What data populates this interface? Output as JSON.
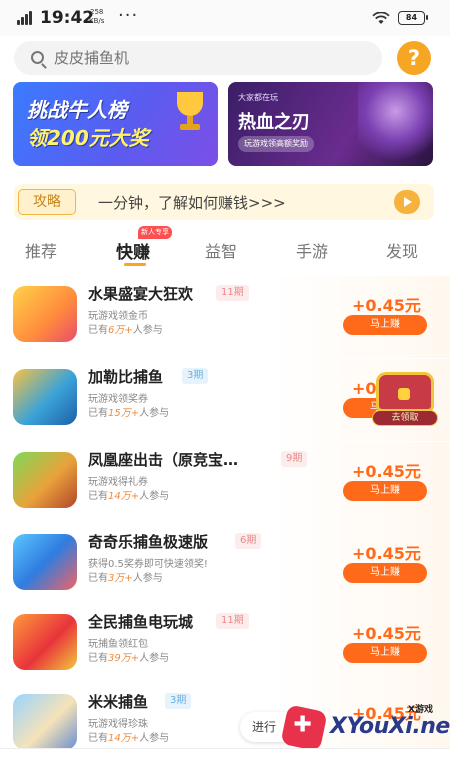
{
  "status_bar": {
    "time": "19:42",
    "net_speed": "258",
    "net_unit": "KB/s",
    "more": "···",
    "battery": "84"
  },
  "search": {
    "placeholder": "皮皮捕鱼机",
    "help_label": "?"
  },
  "banners": [
    {
      "line1": "挑战牛人榜",
      "line2": "领200元大奖"
    },
    {
      "small": "大家都在玩",
      "title": "热血之刃",
      "button": "玩游戏领高额奖励"
    }
  ],
  "guide": {
    "tag": "攻略",
    "text": "一分钟，了解如何赚钱>>>"
  },
  "tabs": [
    {
      "label": "推荐"
    },
    {
      "label": "快赚",
      "badge": "新人专享"
    },
    {
      "label": "益智"
    },
    {
      "label": "手游"
    },
    {
      "label": "发现"
    }
  ],
  "games": [
    {
      "name": "水果盛宴大狂欢",
      "period": "11期",
      "desc": "玩游戏领金币",
      "prefix": "已有",
      "count": "6万+",
      "suffix": "人参与",
      "reward": "+0.45元",
      "button": "马上赚"
    },
    {
      "name": "加勒比捕鱼",
      "period": "3期",
      "desc": "玩游戏领奖券",
      "prefix": "已有",
      "count": "15万+",
      "suffix": "人参与",
      "reward": "+0.45元",
      "button": "马上赚"
    },
    {
      "name": "凤凰座出击（原竞宝…",
      "period": "9期",
      "desc": "玩游戏得礼券",
      "prefix": "已有",
      "count": "14万+",
      "suffix": "人参与",
      "reward": "+0.45元",
      "button": "马上赚"
    },
    {
      "name": "奇奇乐捕鱼极速版",
      "period": "6期",
      "desc": "获得0.5奖券即可快速领奖!",
      "prefix": "已有",
      "count": "3万+",
      "suffix": "人参与",
      "reward": "+0.45元",
      "button": "马上赚"
    },
    {
      "name": "全民捕鱼电玩城",
      "period": "11期",
      "desc": "玩捕鱼领红包",
      "prefix": "已有",
      "count": "39万+",
      "suffix": "人参与",
      "reward": "+0.45元",
      "button": "马上赚"
    },
    {
      "name": "米米捕鱼",
      "period": "3期",
      "desc": "玩游戏得珍珠",
      "prefix": "已有",
      "count": "14万+",
      "suffix": "人参与",
      "reward": "+0.45元",
      "button": "马上赚"
    }
  ],
  "chest": {
    "label": "去领取"
  },
  "floating": {
    "label": "进行"
  },
  "watermark": {
    "small": "X游戏",
    "big": "XYouXi.net"
  },
  "colors": {
    "accent": "#ff6a1a",
    "tab_underline": "#f6a623",
    "help": "#f6a623"
  }
}
